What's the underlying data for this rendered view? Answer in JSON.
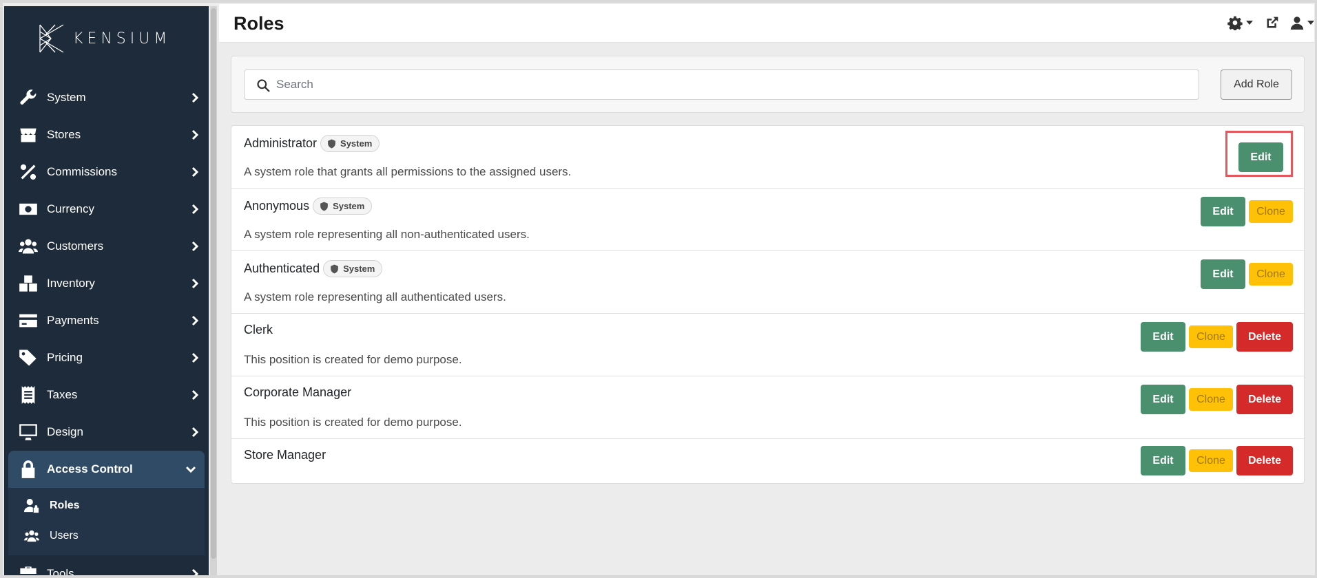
{
  "brand": {
    "name": "KENSIUM"
  },
  "page": {
    "title": "Roles"
  },
  "sidebar": {
    "items": [
      {
        "label": "System",
        "icon": "wrench-icon"
      },
      {
        "label": "Stores",
        "icon": "store-icon"
      },
      {
        "label": "Commissions",
        "icon": "percent-icon"
      },
      {
        "label": "Currency",
        "icon": "money-bill-icon"
      },
      {
        "label": "Customers",
        "icon": "users-icon"
      },
      {
        "label": "Inventory",
        "icon": "boxes-icon"
      },
      {
        "label": "Payments",
        "icon": "credit-card-icon"
      },
      {
        "label": "Pricing",
        "icon": "tags-icon"
      },
      {
        "label": "Taxes",
        "icon": "receipt-icon"
      },
      {
        "label": "Design",
        "icon": "desktop-icon"
      }
    ],
    "active": {
      "label": "Access Control",
      "icon": "lock-icon"
    },
    "submenu": [
      {
        "label": "Roles",
        "icon": "user-lock-icon"
      },
      {
        "label": "Users",
        "icon": "users-icon"
      }
    ],
    "after": {
      "label": "Tools",
      "icon": "toolbox-icon"
    }
  },
  "header": {
    "icons": [
      "gear-icon",
      "external-link-icon",
      "user-icon"
    ]
  },
  "search": {
    "placeholder": "Search",
    "value": ""
  },
  "toolbar": {
    "add_role_label": "Add Role"
  },
  "labels": {
    "edit": "Edit",
    "clone": "Clone",
    "delete": "Delete",
    "system_badge": "System"
  },
  "roles": [
    {
      "name": "Administrator",
      "system": true,
      "description": "A system role that grants all permissions to the assigned users."
    },
    {
      "name": "Anonymous",
      "system": true,
      "description": "A system role representing all non-authenticated users."
    },
    {
      "name": "Authenticated",
      "system": true,
      "description": "A system role representing all authenticated users."
    },
    {
      "name": "Clerk",
      "system": false,
      "description": "This position is created for demo purpose."
    },
    {
      "name": "Corporate Manager",
      "system": false,
      "description": "This position is created for demo purpose."
    },
    {
      "name": "Store Manager",
      "system": false,
      "description": ""
    }
  ],
  "colors": {
    "sidebar_bg": "#1d2b3a",
    "edit": "#4a8f6e",
    "clone": "#ffc107",
    "delete": "#d42a2a",
    "highlight": "#e3585d"
  }
}
